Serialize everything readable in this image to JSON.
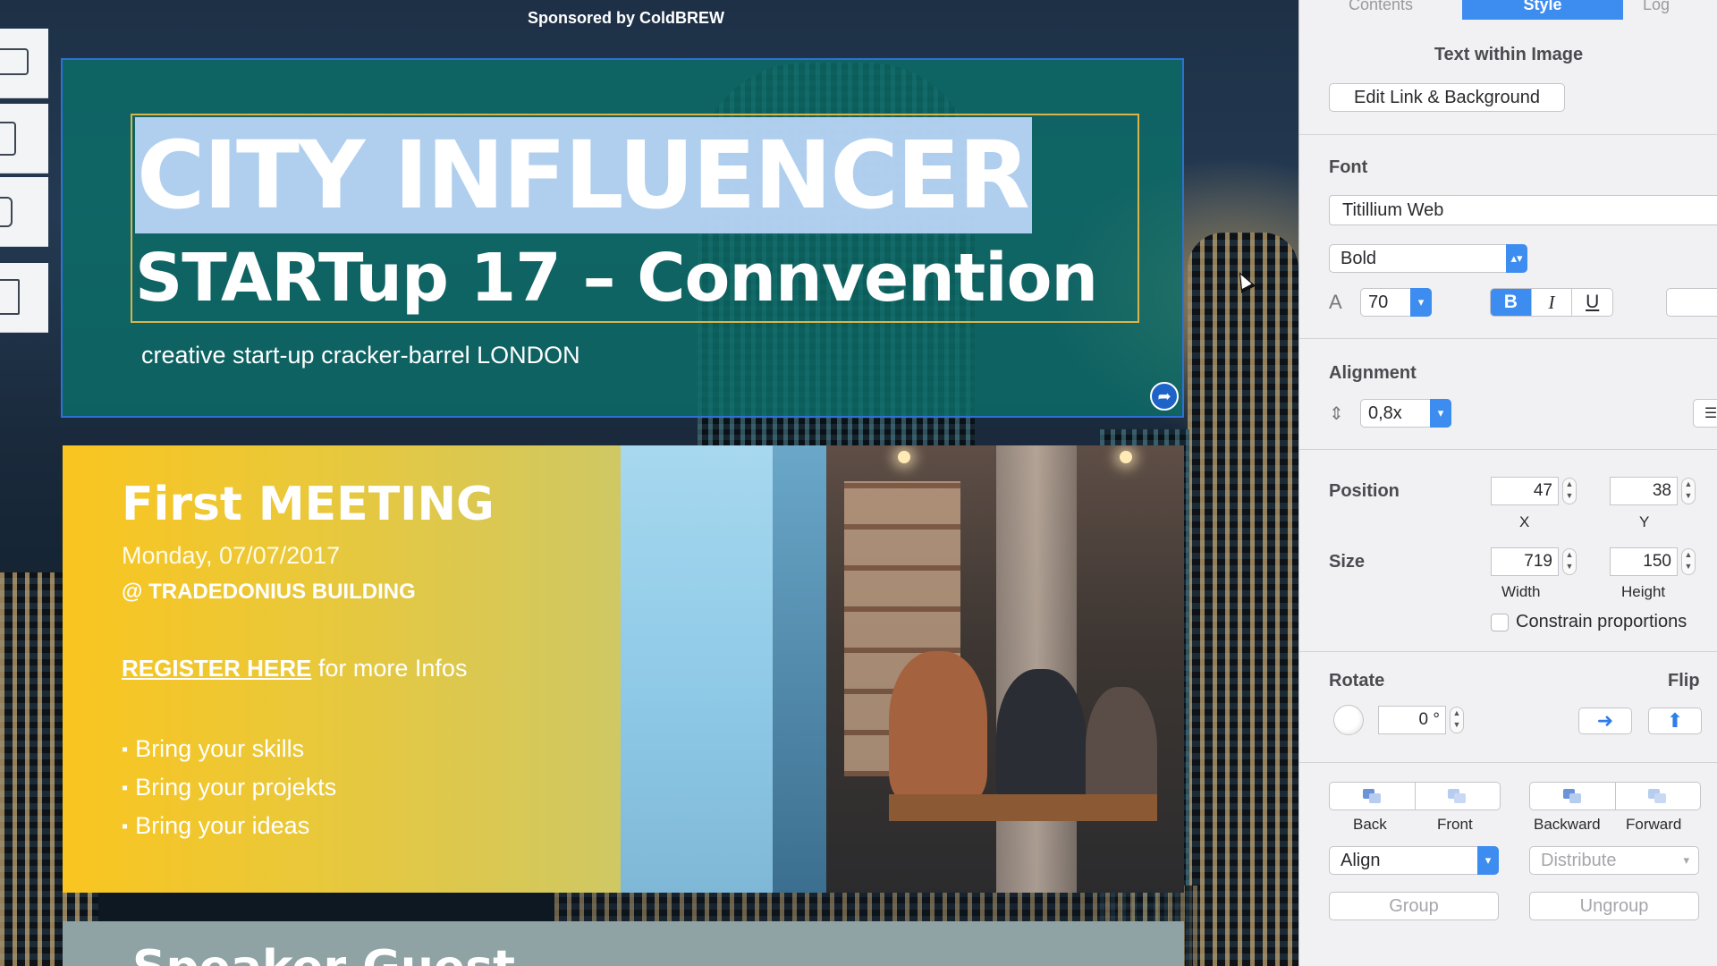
{
  "canvas": {
    "sponsor": "Sponsored by ColdBREW",
    "header": {
      "title_line1": "CITY INFLUENCER",
      "title_line2": "STARTup 17 – Connvention",
      "subtitle": "creative start-up cracker-barrel LONDON"
    },
    "meeting": {
      "title": "First MEETING",
      "date": "Monday, 07/07/2017",
      "place": "@ TRADEDONIUS BUILDING",
      "register_link": "REGISTER HERE",
      "register_rest": " for more Infos",
      "bullets": [
        "Bring your skills",
        "Bring your projekts",
        "Bring your ideas"
      ]
    },
    "speaker": {
      "title": "Speaker Guest"
    }
  },
  "inspector": {
    "tabs": {
      "contents": "Contents",
      "style": "Style",
      "log": "Log"
    },
    "element_type": "Text within Image",
    "edit_link_button": "Edit Link & Background",
    "font": {
      "heading": "Font",
      "family": "Titillium Web",
      "weight": "Bold",
      "size": "70",
      "bold": "B",
      "italic": "I",
      "underline": "U"
    },
    "alignment": {
      "heading": "Alignment",
      "line_spacing": "0,8x"
    },
    "position": {
      "heading": "Position",
      "x": "47",
      "y": "38",
      "x_label": "X",
      "y_label": "Y"
    },
    "size": {
      "heading": "Size",
      "width": "719",
      "height": "150",
      "width_label": "Width",
      "height_label": "Height",
      "constrain": "Constrain proportions"
    },
    "rotate": {
      "heading": "Rotate",
      "value": "0 °",
      "flip_heading": "Flip"
    },
    "arrange": {
      "back": "Back",
      "front": "Front",
      "backward": "Backward",
      "forward": "Forward",
      "align": "Align",
      "distribute": "Distribute",
      "group": "Group",
      "ungroup": "Ungroup"
    }
  }
}
